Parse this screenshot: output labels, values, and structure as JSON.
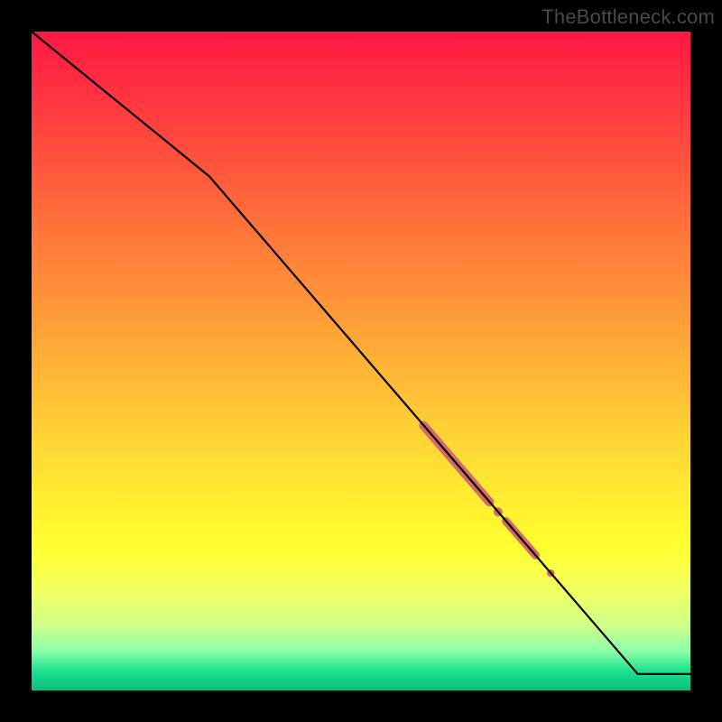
{
  "watermark": "TheBottleneck.com",
  "colors": {
    "line": "#000000",
    "highlight": "#d66a6a",
    "frame": "#000000"
  },
  "chart_data": {
    "type": "line",
    "title": "",
    "xlabel": "",
    "ylabel": "",
    "xlim": [
      0,
      100
    ],
    "ylim": [
      0,
      100
    ],
    "grid": false,
    "legend": false,
    "series": [
      {
        "name": "curve",
        "x": [
          0,
          27,
          92,
          100
        ],
        "values": [
          100,
          78,
          2.5,
          2.5
        ]
      }
    ],
    "highlight_segments": [
      {
        "x0": 59.5,
        "y0": 40.2,
        "x1": 69.5,
        "y1": 28.6,
        "width": 10
      },
      {
        "x0": 72.0,
        "y0": 25.7,
        "x1": 76.5,
        "y1": 20.5,
        "width": 9
      }
    ],
    "highlight_points": [
      {
        "x": 70.8,
        "y": 27.1,
        "r": 5
      },
      {
        "x": 78.8,
        "y": 17.8,
        "r": 4.2
      }
    ]
  }
}
